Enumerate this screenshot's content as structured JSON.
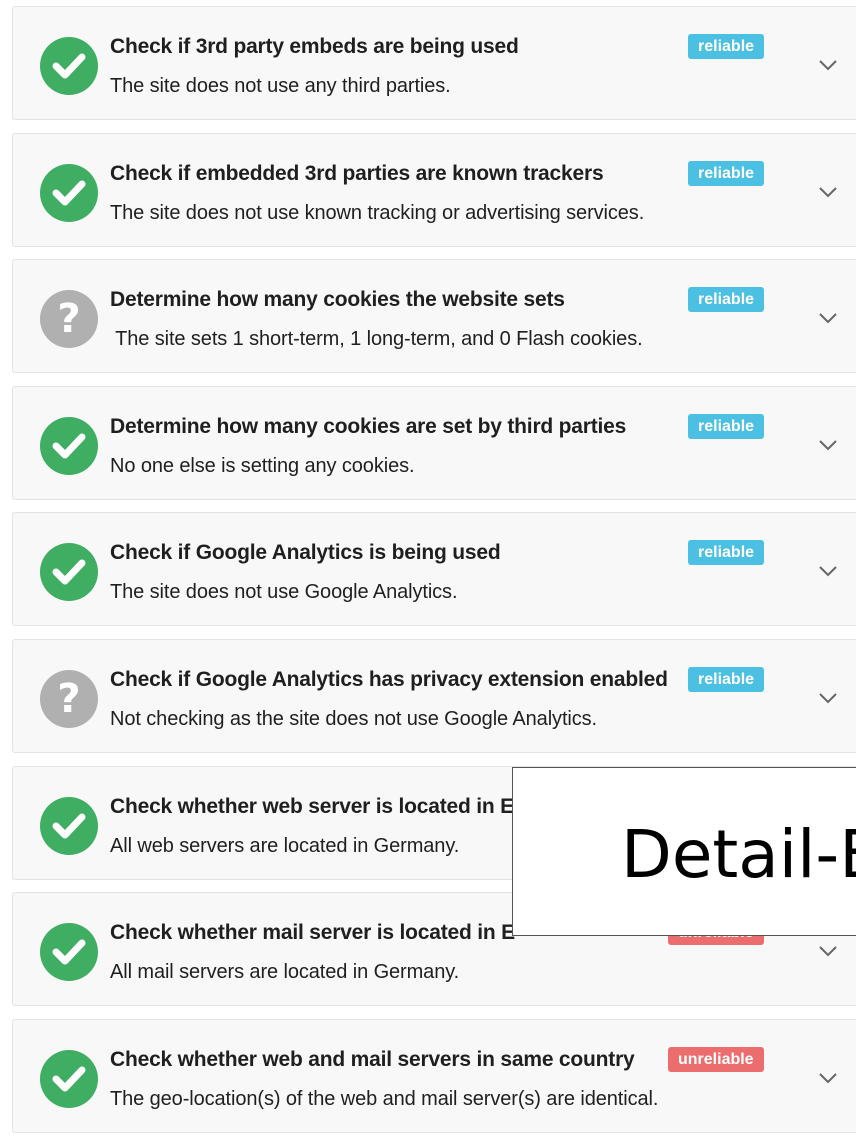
{
  "colors": {
    "pass": "#3fae63",
    "unknown": "#b0b0b0",
    "reliable": "#4cc0e3",
    "unreliable": "#ec6d6d"
  },
  "checks": [
    {
      "status": "pass",
      "title": "Check if 3rd party embeds are being used",
      "badge": "reliable",
      "description": "The site does not use any third parties."
    },
    {
      "status": "pass",
      "title": "Check if embedded 3rd parties are known trackers",
      "badge": "reliable",
      "description": "The site does not use known tracking or advertising services."
    },
    {
      "status": "unknown",
      "title": "Determine how many cookies the website sets",
      "badge": "reliable",
      "description": " The site sets 1 short-term, 1 long-term, and 0 Flash cookies."
    },
    {
      "status": "pass",
      "title": "Determine how many cookies are set by third parties",
      "badge": "reliable",
      "description": "No one else is setting any cookies."
    },
    {
      "status": "pass",
      "title": "Check if Google Analytics is being used",
      "badge": "reliable",
      "description": "The site does not use Google Analytics."
    },
    {
      "status": "unknown",
      "title": "Check if Google Analytics has privacy extension enabled",
      "badge": "reliable",
      "description": "Not checking as the site does not use Google Analytics."
    },
    {
      "status": "pass",
      "title": "Check whether web server is located in E",
      "badge": "",
      "description": "All web servers are located in Germany."
    },
    {
      "status": "pass",
      "title": "Check whether mail server is located in E",
      "badge": "unreliable",
      "description": "All mail servers are located in Germany."
    },
    {
      "status": "pass",
      "title": "Check whether web and mail servers in same country",
      "badge": "unreliable",
      "description": "The geo-location(s) of the web and mail server(s) are identical."
    }
  ],
  "overlay": {
    "text": "Detail-E"
  }
}
